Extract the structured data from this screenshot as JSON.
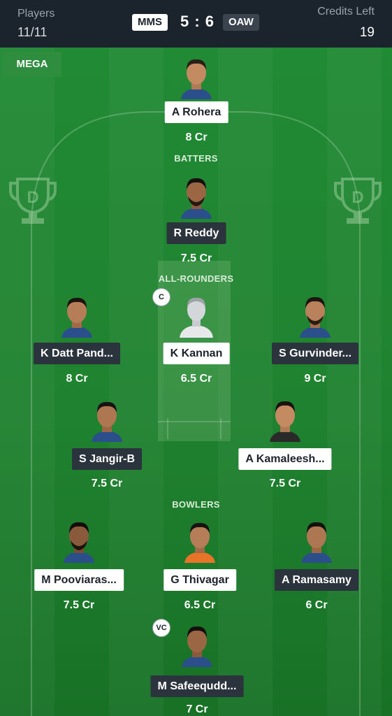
{
  "header": {
    "players_label": "Players",
    "players_value": "11/11",
    "team_a": "MMS",
    "score": "5 : 6",
    "team_b": "OAW",
    "credits_label": "Credits Left",
    "credits_value": "19"
  },
  "badge": {
    "mega": "MEGA"
  },
  "sections": {
    "batters": "BATTERS",
    "allrounders": "ALL-ROUNDERS",
    "bowlers": "BOWLERS"
  },
  "players": {
    "wk": {
      "name": "A Rohera",
      "credits": "8 Cr"
    },
    "bat1": {
      "name": "R Reddy",
      "credits": "7.5 Cr"
    },
    "ar1": {
      "name": "K Datt Pand...",
      "credits": "8 Cr"
    },
    "ar2": {
      "name": "K Kannan",
      "credits": "6.5 Cr",
      "role": "C"
    },
    "ar3": {
      "name": "S Gurvinder...",
      "credits": "9 Cr"
    },
    "ar4": {
      "name": "S Jangir-B",
      "credits": "7.5 Cr"
    },
    "ar5": {
      "name": "A Kamaleesh...",
      "credits": "7.5 Cr"
    },
    "bowl1": {
      "name": "M Pooviaras...",
      "credits": "7.5 Cr"
    },
    "bowl2": {
      "name": "G Thivagar",
      "credits": "6.5 Cr"
    },
    "bowl3": {
      "name": "A Ramasamy",
      "credits": "6 Cr"
    },
    "bowl4": {
      "name": "M Safeequdd...",
      "credits": "7 Cr",
      "role": "VC"
    }
  },
  "icons": {
    "avatar": "player-avatar-icon",
    "placeholder": "placeholder-avatar-icon",
    "trophy": "dream-trophy-icon"
  }
}
